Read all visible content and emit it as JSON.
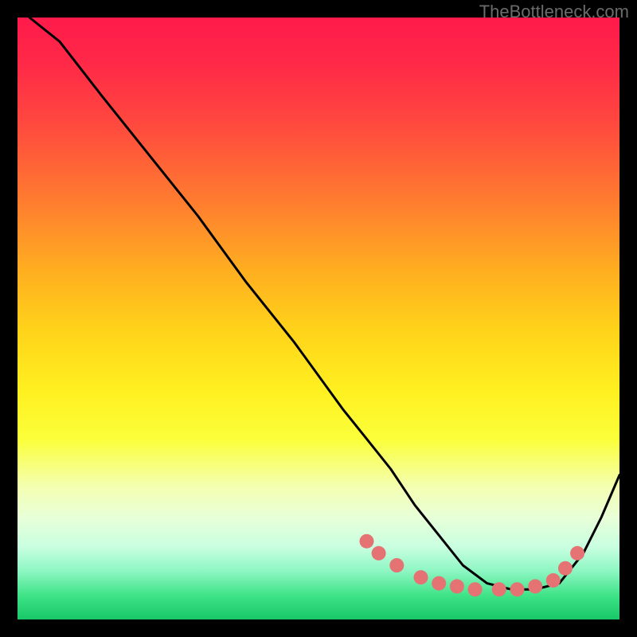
{
  "watermark": "TheBottleneck.com",
  "chart_data": {
    "type": "line",
    "title": "",
    "xlabel": "",
    "ylabel": "",
    "xlim": [
      0,
      100
    ],
    "ylim": [
      0,
      100
    ],
    "grid": false,
    "series": [
      {
        "name": "bottleneck-curve",
        "x": [
          2,
          7,
          14,
          22,
          30,
          38,
          46,
          54,
          58,
          62,
          66,
          70,
          74,
          78,
          82,
          86,
          90,
          94,
          97,
          100
        ],
        "y": [
          100,
          96,
          87,
          77,
          67,
          56,
          46,
          35,
          30,
          25,
          19,
          14,
          9,
          6,
          5,
          5,
          6,
          11,
          17,
          24
        ]
      }
    ],
    "markers": {
      "name": "optimal-region-dots",
      "x": [
        58,
        60,
        63,
        67,
        70,
        73,
        76,
        80,
        83,
        86,
        89,
        91,
        93
      ],
      "y": [
        13,
        11,
        9,
        7,
        6,
        5.5,
        5,
        5,
        5,
        5.5,
        6.5,
        8.5,
        11
      ]
    },
    "colors": {
      "line": "#000000",
      "marker": "#e57373"
    }
  }
}
